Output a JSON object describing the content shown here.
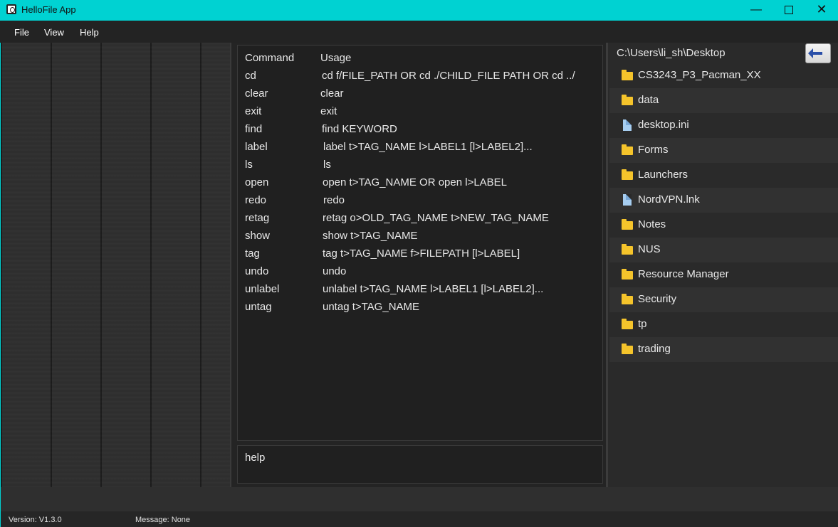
{
  "window": {
    "title": "HelloFile App"
  },
  "menu": {
    "file": "File",
    "view": "View",
    "help": "Help"
  },
  "commands": {
    "header": {
      "name": "Command",
      "usage": "Usage"
    },
    "rows": [
      {
        "name": "cd",
        "usage": "cd f/FILE_PATH OR cd ./CHILD_FILE PATH OR cd ../"
      },
      {
        "name": "clear",
        "usage": "clear"
      },
      {
        "name": "exit",
        "usage": "exit"
      },
      {
        "name": "find",
        "usage": "find KEYWORD"
      },
      {
        "name": "label",
        "usage": "label t>TAG_NAME l>LABEL1 [l>LABEL2]..."
      },
      {
        "name": "ls",
        "usage": "ls"
      },
      {
        "name": "open",
        "usage": "open t>TAG_NAME OR open l>LABEL"
      },
      {
        "name": "redo",
        "usage": "redo"
      },
      {
        "name": "retag",
        "usage": "retag o>OLD_TAG_NAME t>NEW_TAG_NAME"
      },
      {
        "name": "show",
        "usage": "show t>TAG_NAME"
      },
      {
        "name": "tag",
        "usage": "tag t>TAG_NAME f>FILEPATH [l>LABEL]"
      },
      {
        "name": "undo",
        "usage": "undo"
      },
      {
        "name": "unlabel",
        "usage": "unlabel t>TAG_NAME l>LABEL1 [l>LABEL2]..."
      },
      {
        "name": "untag",
        "usage": "untag t>TAG_NAME"
      }
    ]
  },
  "command_input": {
    "value": "help"
  },
  "explorer": {
    "path": "C:\\Users\\li_sh\\Desktop",
    "files": [
      {
        "name": "CS3243_P3_Pacman_XX",
        "icon": "folder-icon"
      },
      {
        "name": "data",
        "icon": "folder-icon"
      },
      {
        "name": "desktop.ini",
        "icon": "file-icon"
      },
      {
        "name": "Forms",
        "icon": "folder-icon"
      },
      {
        "name": "Launchers",
        "icon": "folder-icon"
      },
      {
        "name": "NordVPN.lnk",
        "icon": "file-icon"
      },
      {
        "name": "Notes",
        "icon": "folder-icon"
      },
      {
        "name": "NUS",
        "icon": "folder-icon"
      },
      {
        "name": "Resource Manager",
        "icon": "folder-icon"
      },
      {
        "name": "Security",
        "icon": "folder-icon"
      },
      {
        "name": "tp",
        "icon": "folder-icon"
      },
      {
        "name": "trading",
        "icon": "folder-icon"
      }
    ]
  },
  "status": {
    "version": "Version:  V1.3.0",
    "message": "Message:  None"
  },
  "colors": {
    "titlebar": "#00d2d2",
    "folder": "#f5c42b",
    "file": "#a6cdf0",
    "back_arrow": "#2a4fa8"
  }
}
